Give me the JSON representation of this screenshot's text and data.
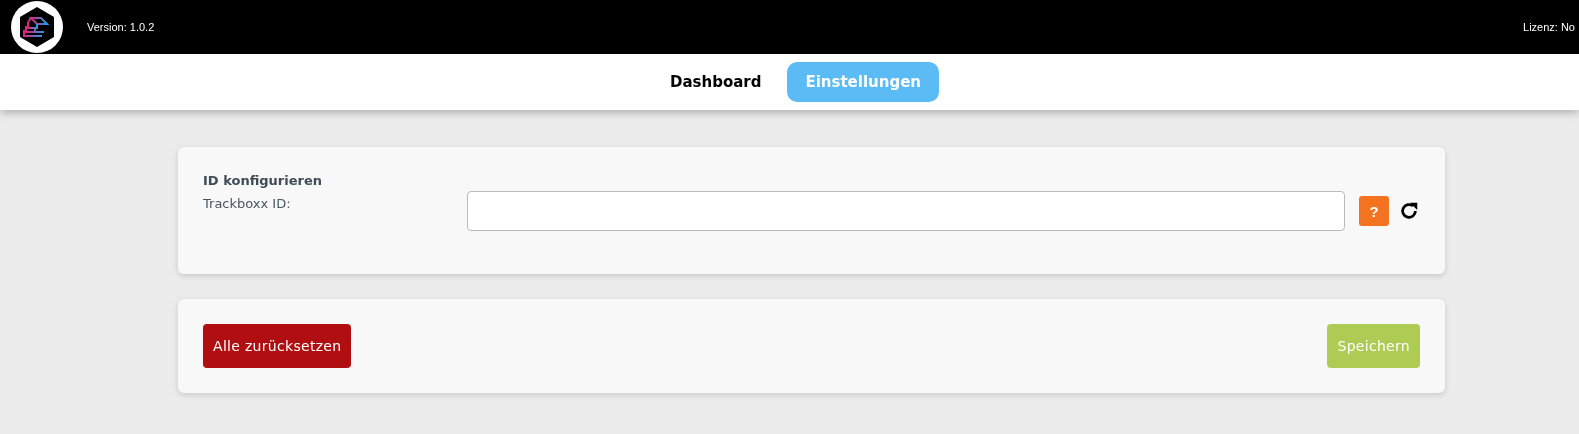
{
  "header": {
    "version": "Version: 1.0.2",
    "license": "Lizenz: No"
  },
  "tabs": [
    {
      "label": "Dashboard",
      "selected": false
    },
    {
      "label": "Einstellungen",
      "selected": true
    }
  ],
  "id_card": {
    "title": "ID konfigurieren",
    "field_label": "Trackboxx ID:",
    "help": "?"
  },
  "actions": {
    "reset": "Alle zurücksetzen",
    "save": "Speichern"
  }
}
